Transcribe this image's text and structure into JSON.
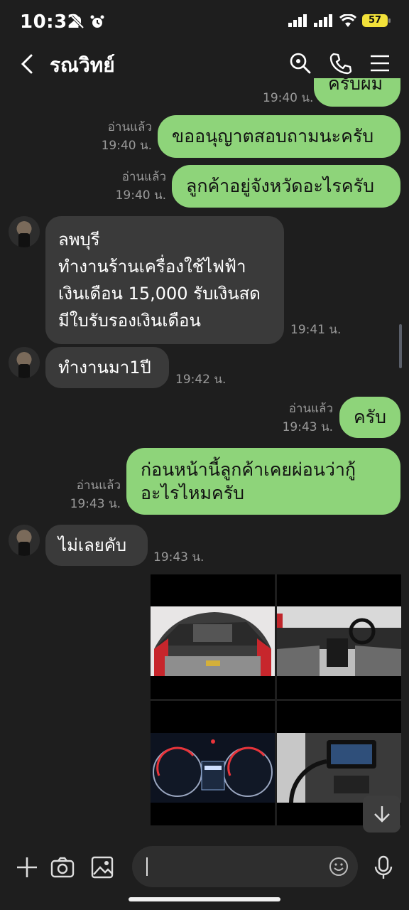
{
  "status": {
    "time": "10:32",
    "battery": "57"
  },
  "header": {
    "title": "รณวิทย์"
  },
  "messages": {
    "m0": {
      "text": "ครับผม",
      "time": "19:40 น."
    },
    "m1": {
      "text": "ขออนุญาตสอบถามนะครับ",
      "read": "อ่านแล้ว",
      "time": "19:40 น."
    },
    "m2": {
      "text": "ลูกค้าอยู่จังหวัดอะไรครับ",
      "read": "อ่านแล้ว",
      "time": "19:40 น."
    },
    "m3": {
      "lines": [
        "ลพบุรี",
        "ทำงานร้านเครื่องใช้ไฟฟ้า",
        "เงินเดือน 15,000 รับเงินสด",
        "มีใบรับรองเงินเดือน"
      ],
      "time": "19:41 น."
    },
    "m4": {
      "text": "ทำงานมา1ปี",
      "time": "19:42 น."
    },
    "m5": {
      "text": "ครับ",
      "read": "อ่านแล้ว",
      "time": "19:43 น."
    },
    "m6": {
      "lines": [
        "ก่อนหน้านี้ลูกค้าเคยผ่อนว่ากู้",
        "อะไรไหมครับ"
      ],
      "read": "อ่านแล้ว",
      "time": "19:43 น."
    },
    "m7": {
      "text": "ไม่เลยคับ",
      "time": "19:43 น."
    }
  },
  "photos": [
    "engine-bay-photo",
    "car-interior-photo",
    "dashboard-gauges-photo",
    "center-console-photo"
  ],
  "colors": {
    "outgoing_bubble": "#8ed47a",
    "incoming_bubble": "#3a3a3a",
    "background": "#1e1e1e",
    "battery": "#f2e13a"
  }
}
